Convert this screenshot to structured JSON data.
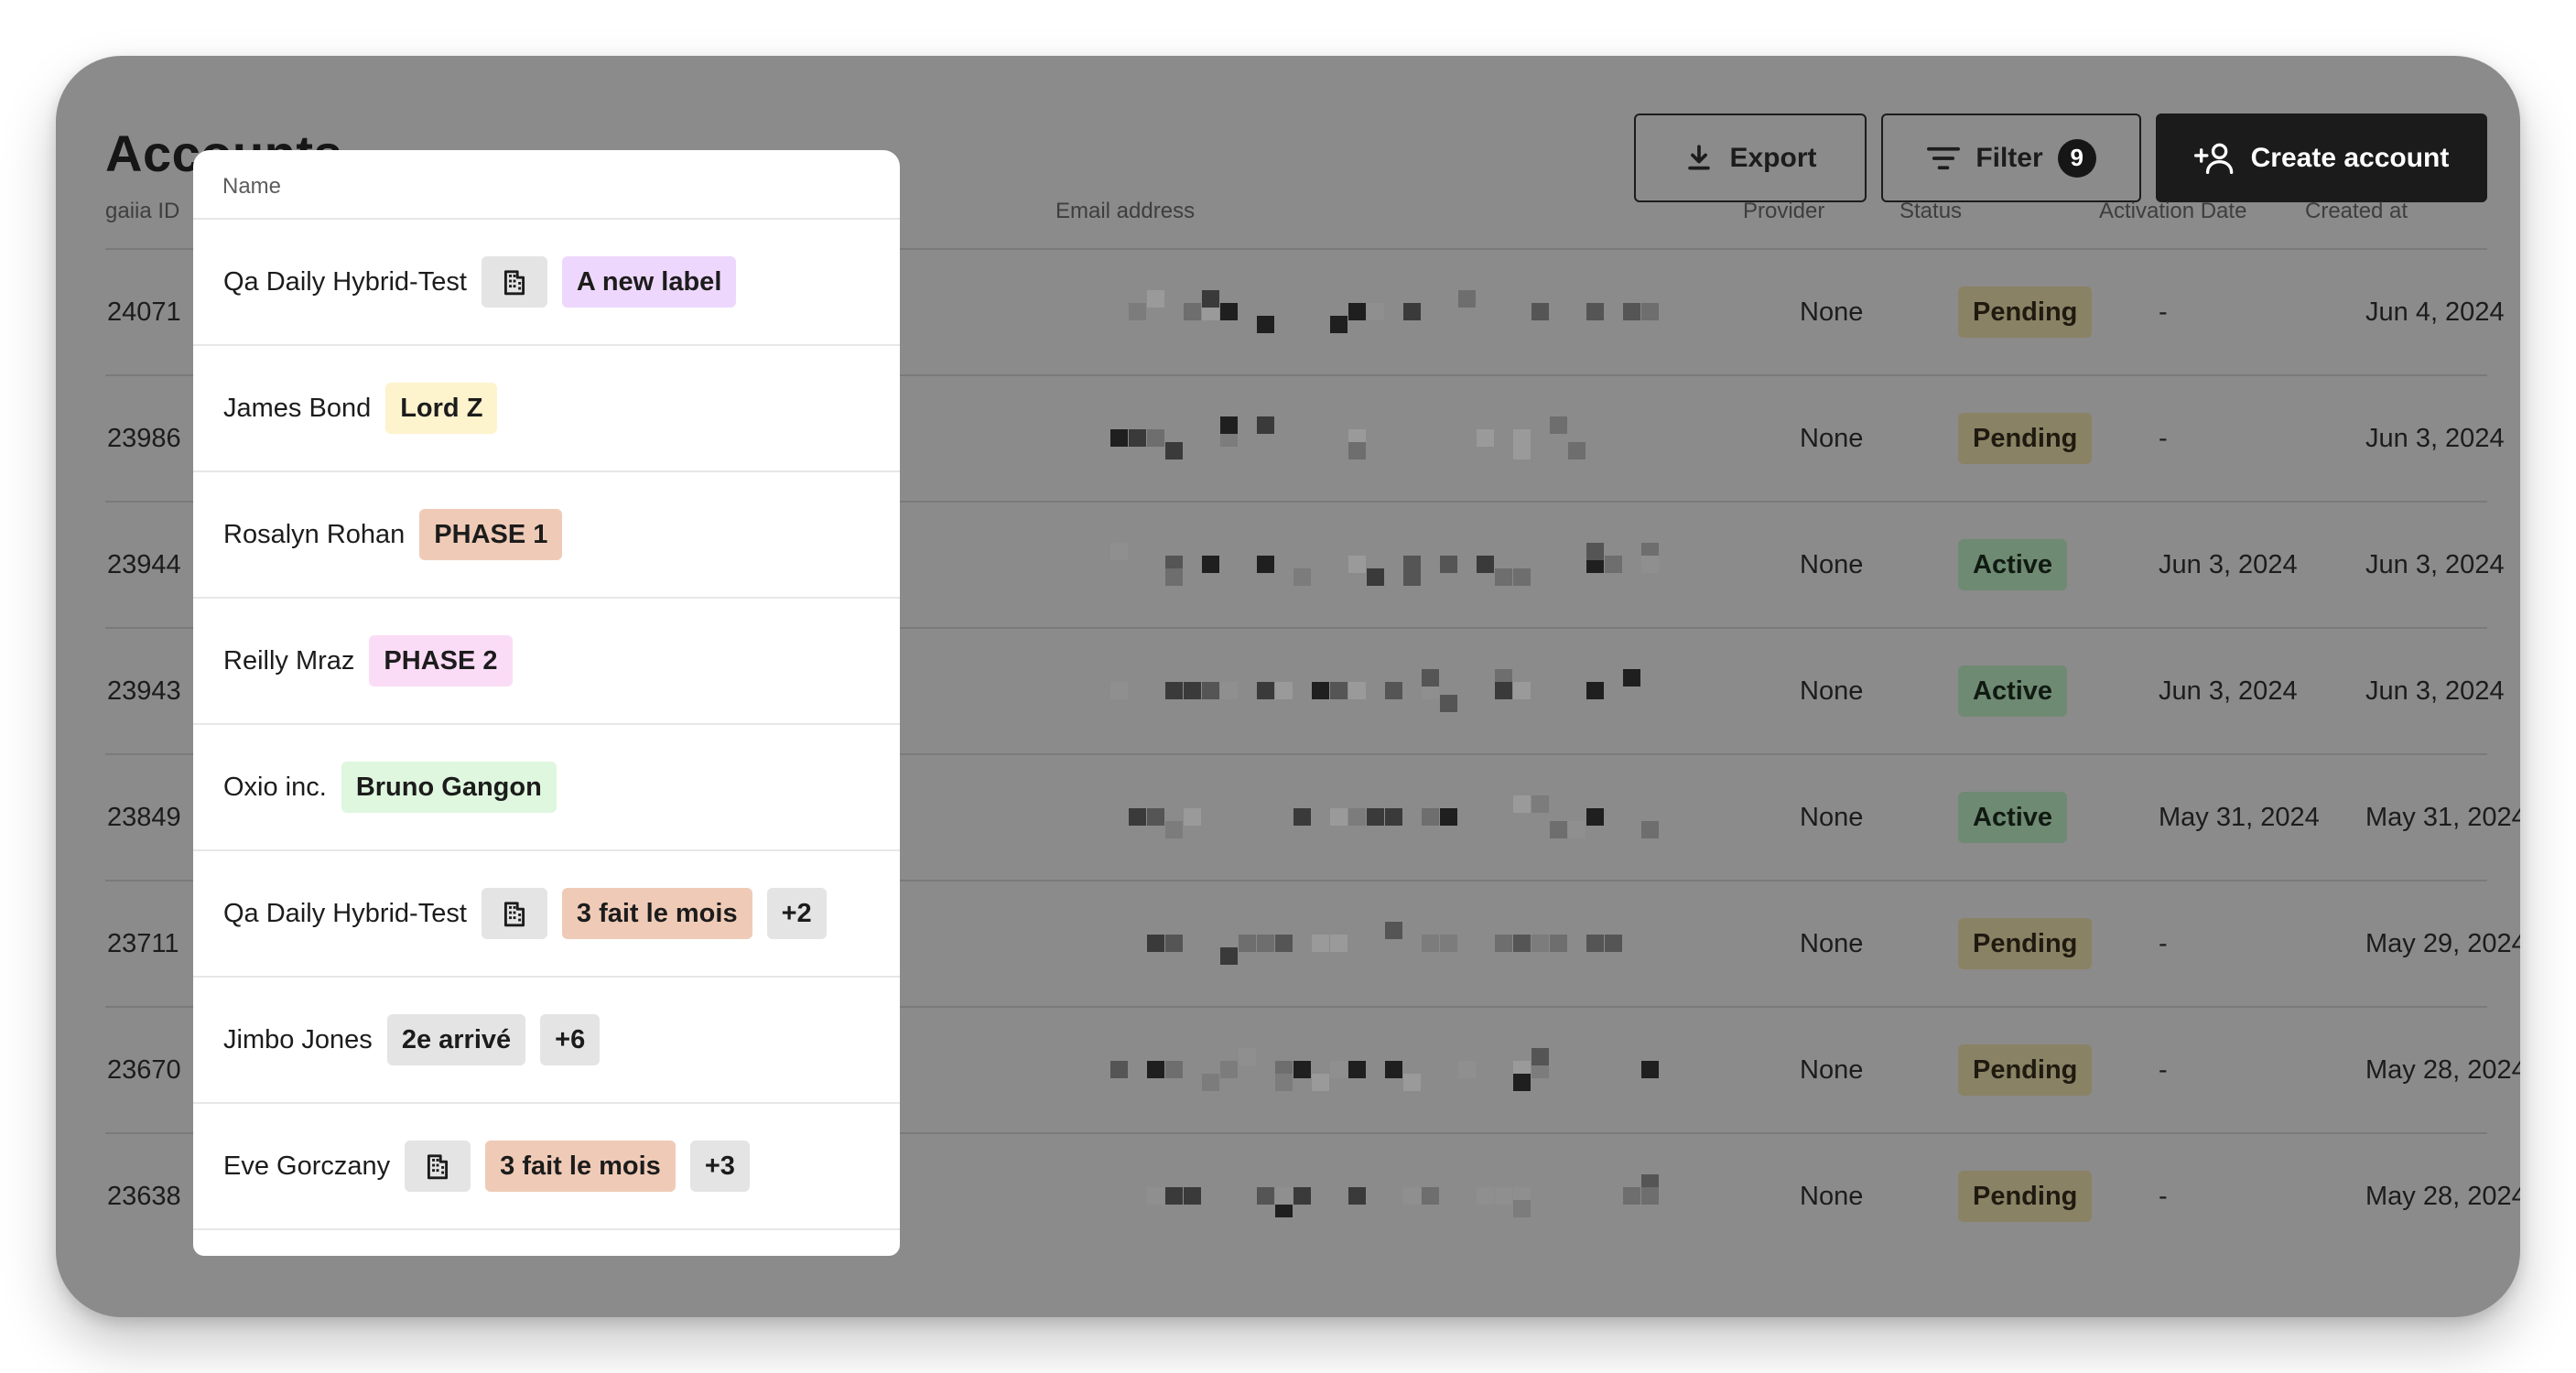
{
  "header": {
    "title": "Accounts",
    "export_label": "Export",
    "filter_label": "Filter",
    "filter_count": "9",
    "create_label": "Create account"
  },
  "columns": {
    "id": "gaiia ID",
    "name": "Name",
    "email": "Email address",
    "provider": "Provider",
    "status": "Status",
    "activation": "Activation Date",
    "created": "Created at"
  },
  "sort": {
    "column": "gaiia ID",
    "direction": "descending",
    "icon": "arrow-down-icon"
  },
  "colors": {
    "overlay": "#8b8b8b",
    "status_pending": "#8a8264",
    "status_active": "#6f8a72",
    "tag_purple": "#eed7fc",
    "tag_yellow": "#fdf3cd",
    "tag_salmon": "#efcbb7",
    "tag_pink": "#fbdcf6",
    "tag_green": "#dff6df",
    "tag_gray": "#e4e4e4"
  },
  "rows": [
    {
      "id": "24071",
      "name": "Qa Daily Hybrid-Test",
      "building": true,
      "tags": [
        {
          "label": "A new label",
          "color": "#eed7fc"
        }
      ],
      "provider": "None",
      "status": "Pending",
      "activation": "-",
      "created": "Jun 4, 2024"
    },
    {
      "id": "23986",
      "name": "James Bond",
      "building": false,
      "tags": [
        {
          "label": "Lord Z",
          "color": "#fdf3cd"
        }
      ],
      "provider": "None",
      "status": "Pending",
      "activation": "-",
      "created": "Jun 3, 2024"
    },
    {
      "id": "23944",
      "name": "Rosalyn Rohan",
      "building": false,
      "tags": [
        {
          "label": "PHASE 1",
          "color": "#efcbb7"
        }
      ],
      "provider": "None",
      "status": "Active",
      "activation": "Jun 3, 2024",
      "created": "Jun 3, 2024"
    },
    {
      "id": "23943",
      "name": "Reilly Mraz",
      "building": false,
      "tags": [
        {
          "label": "PHASE 2",
          "color": "#fbdcf6"
        }
      ],
      "provider": "None",
      "status": "Active",
      "activation": "Jun 3, 2024",
      "created": "Jun 3, 2024"
    },
    {
      "id": "23849",
      "name": "Oxio inc.",
      "building": false,
      "tags": [
        {
          "label": "Bruno Gangon",
          "color": "#dff6df"
        }
      ],
      "provider": "None",
      "status": "Active",
      "activation": "May 31, 2024",
      "created": "May 31, 2024"
    },
    {
      "id": "23711",
      "name": "Qa Daily Hybrid-Test",
      "building": true,
      "tags": [
        {
          "label": "3 fait le mois",
          "color": "#efcbb7"
        },
        {
          "label": "+2",
          "color": "#e4e4e4"
        }
      ],
      "provider": "None",
      "status": "Pending",
      "activation": "-",
      "created": "May 29, 2024"
    },
    {
      "id": "23670",
      "name": "Jimbo Jones",
      "building": false,
      "tags": [
        {
          "label": "2e arrivé",
          "color": "#e4e4e4"
        },
        {
          "label": "+6",
          "color": "#e4e4e4"
        }
      ],
      "provider": "None",
      "status": "Pending",
      "activation": "-",
      "created": "May 28, 2024"
    },
    {
      "id": "23638",
      "name": "Eve Gorczany",
      "building": true,
      "tags": [
        {
          "label": "3 fait le mois",
          "color": "#efcbb7"
        },
        {
          "label": "+3",
          "color": "#e4e4e4"
        }
      ],
      "provider": "None",
      "status": "Pending",
      "activation": "-",
      "created": "May 28, 2024"
    }
  ]
}
